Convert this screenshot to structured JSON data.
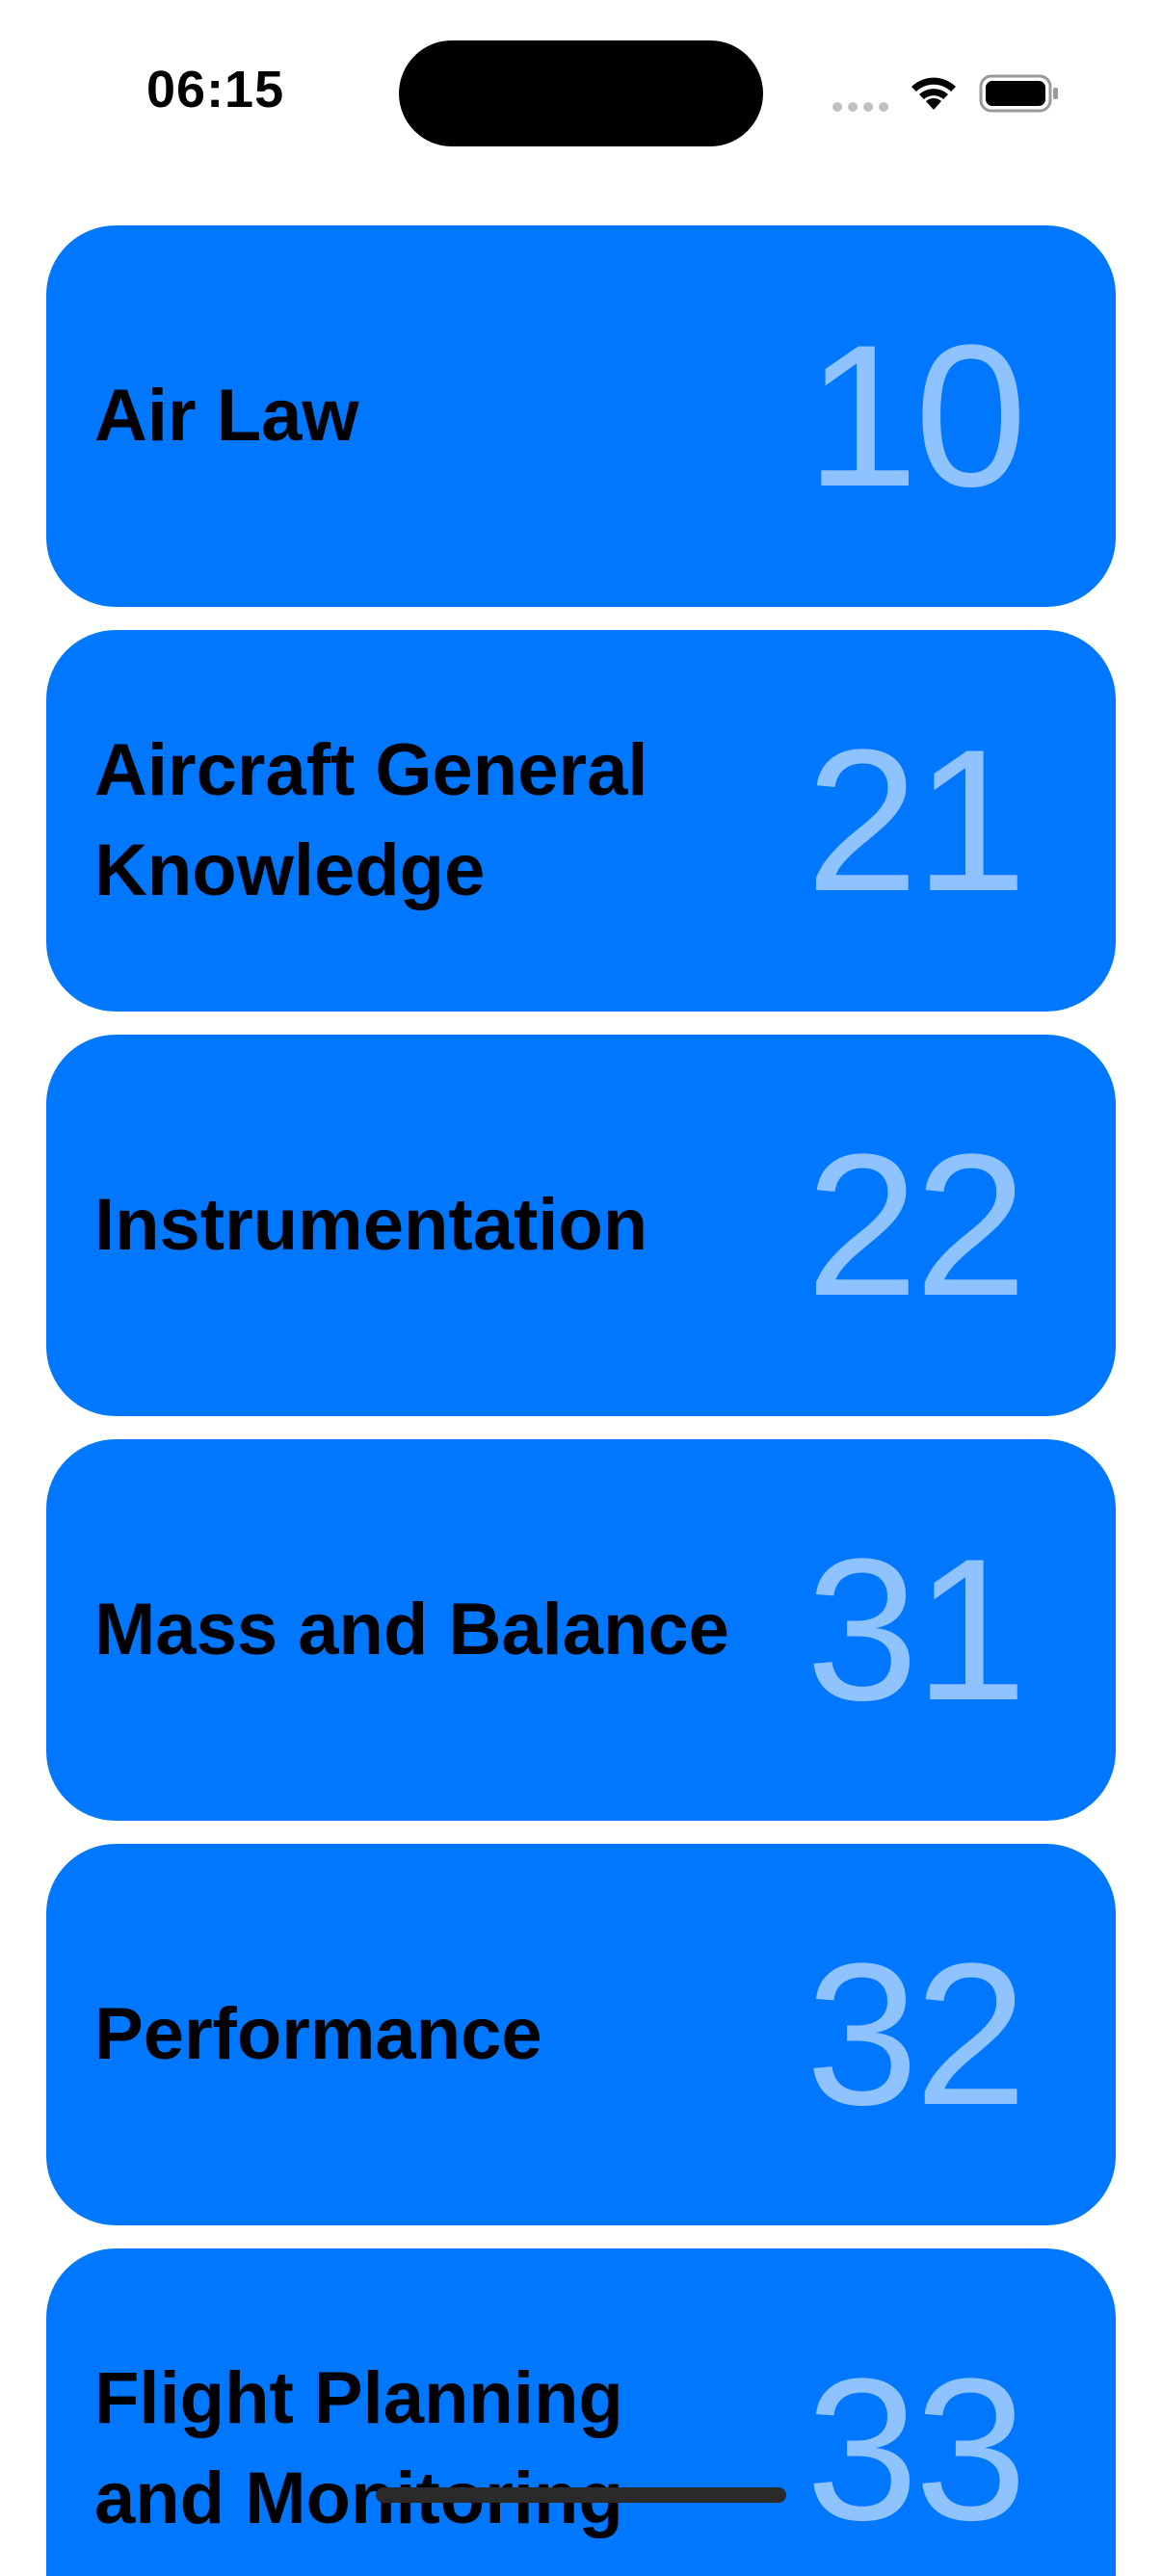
{
  "status_bar": {
    "time": "06:15"
  },
  "colors": {
    "card_background": "#0077FF",
    "number_color": "#8EC3FF",
    "title_color": "#000000"
  },
  "subjects": [
    {
      "title": "Air Law",
      "number": "10"
    },
    {
      "title": "Aircraft General Knowledge",
      "number": "21"
    },
    {
      "title": "Instrumentation",
      "number": "22"
    },
    {
      "title": "Mass and Balance",
      "number": "31"
    },
    {
      "title": "Performance",
      "number": "32"
    },
    {
      "title": "Flight Planning and Monitoring",
      "number": "33"
    }
  ]
}
